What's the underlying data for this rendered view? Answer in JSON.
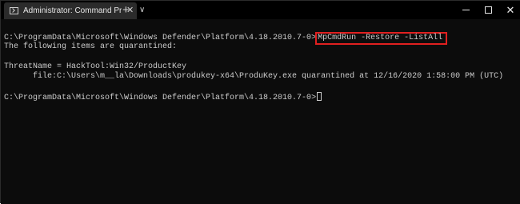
{
  "window": {
    "tab_title": "Administrator: Command Prompt",
    "new_tab_glyph": "+",
    "dropdown_glyph": "∨",
    "close_glyph": "✕",
    "tab_close_glyph": "✕"
  },
  "console": {
    "prompt1": "C:\\ProgramData\\Microsoft\\Windows Defender\\Platform\\4.18.2010.7-0>",
    "command": "MpCmdRun -Restore -ListAll",
    "output_line1": "The following items are quarantined:",
    "threat_line": "ThreatName = HackTool:Win32/ProductKey",
    "file_line": "      file:C:\\Users\\m__la\\Downloads\\produkey-x64\\ProduKey.exe quarantined at 12/16/2020 1:58:00 PM (UTC)",
    "prompt2": "C:\\ProgramData\\Microsoft\\Windows Defender\\Platform\\4.18.2010.7-0>"
  },
  "colors": {
    "background": "#0c0c0c",
    "text": "#cccccc",
    "highlight_box": "#e02020"
  }
}
